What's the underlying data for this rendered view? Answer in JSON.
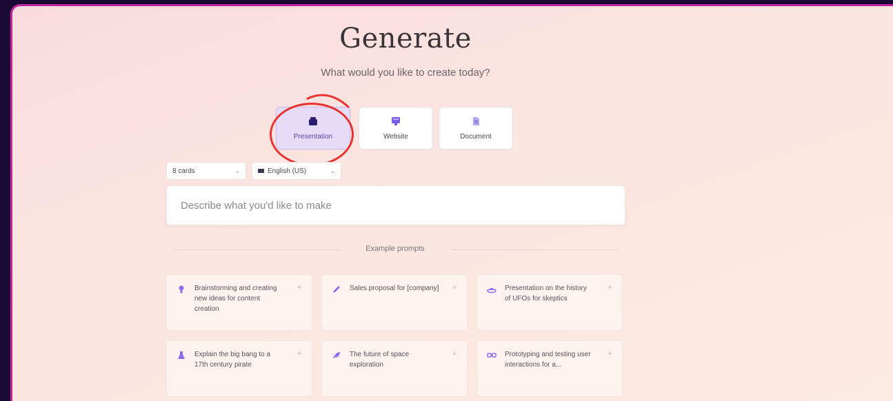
{
  "header": {
    "title": "Generate",
    "subtitle": "What would you like to create today?"
  },
  "types": [
    {
      "label": "Presentation",
      "icon": "presentation-icon",
      "selected": true
    },
    {
      "label": "Website",
      "icon": "website-icon",
      "selected": false
    },
    {
      "label": "Document",
      "icon": "document-icon",
      "selected": false
    }
  ],
  "options": {
    "cards": "8 cards",
    "language": "English (US)"
  },
  "prompt": {
    "placeholder": "Describe what you'd like to make"
  },
  "examples": {
    "heading": "Example prompts",
    "items": [
      {
        "text": "Brainstorming and creating new ideas for content creation",
        "icon": "lightbulb-icon"
      },
      {
        "text": "Sales proposal for [company]",
        "icon": "pencil-icon"
      },
      {
        "text": "Presentation on the history of UFOs for skeptics",
        "icon": "ufo-icon"
      },
      {
        "text": "Explain the big bang to a 17th century pirate",
        "icon": "flask-icon"
      },
      {
        "text": "The future of space exploration",
        "icon": "rocket-icon"
      },
      {
        "text": "Prototyping and testing user interactions for a...",
        "icon": "vr-goggles-icon"
      }
    ]
  },
  "colors": {
    "accent": "#6a4ad0",
    "annotation": "#e8322f",
    "frame_border": "#c2259e"
  }
}
